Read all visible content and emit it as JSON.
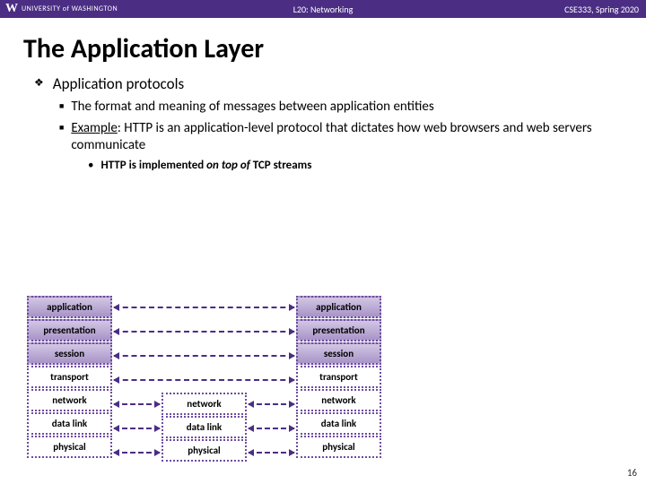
{
  "header": {
    "university": "UNIVERSITY of WASHINGTON",
    "lecture": "L20: Networking",
    "course": "CSE333, Spring 2020"
  },
  "title": "The Application Layer",
  "bullets": {
    "lvl1": "Application protocols",
    "lvl2a": "The format and meaning of messages between application entities",
    "lvl2b_pre": "Example",
    "lvl2b_post": ": HTTP is an application-level protocol that dictates how web browsers and web servers communicate",
    "lvl3_pre": "HTTP is implemented ",
    "lvl3_it": "on top of",
    "lvl3_post": " TCP streams"
  },
  "layers": {
    "application": "application",
    "presentation": "presentation",
    "session": "session",
    "transport": "transport",
    "network": "network",
    "datalink": "data link",
    "physical": "physical"
  },
  "slide_number": "16"
}
